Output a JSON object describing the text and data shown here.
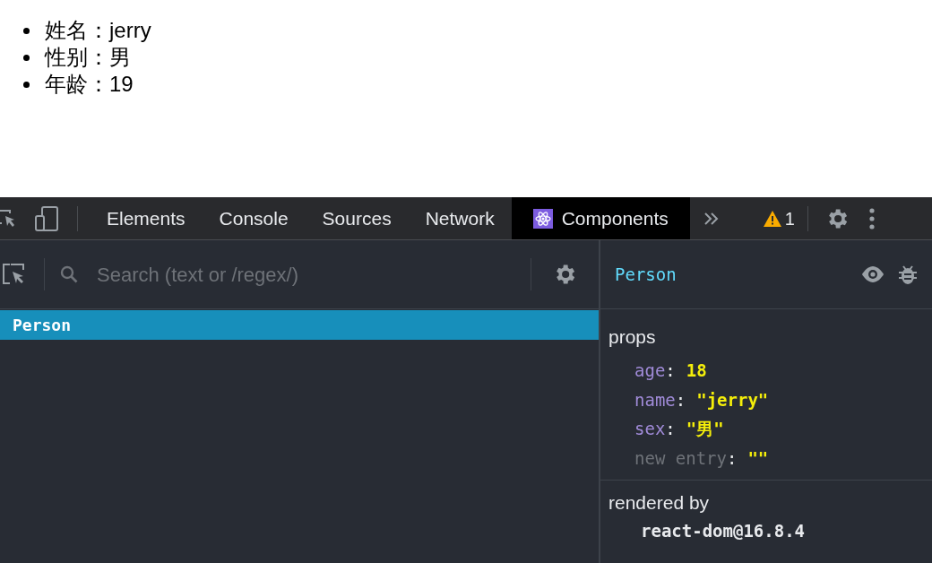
{
  "page_list": [
    "姓名：jerry",
    "性别：男",
    "年龄：19"
  ],
  "tabs": [
    {
      "label": "Elements",
      "selected": false
    },
    {
      "label": "Console",
      "selected": false
    },
    {
      "label": "Sources",
      "selected": false
    },
    {
      "label": "Network",
      "selected": false
    },
    {
      "label": "Components",
      "selected": true,
      "kind": "react"
    }
  ],
  "warning_count": "1",
  "search": {
    "placeholder": "Search (text or /regex/)"
  },
  "tree": [
    {
      "label": "Person",
      "selected": true
    }
  ],
  "inspector": {
    "component": "Person",
    "props_title": "props",
    "separator": ":",
    "props": [
      {
        "kind": "prop",
        "key": "age",
        "value": "18"
      },
      {
        "kind": "prop",
        "key": "name",
        "value": "\"jerry\""
      },
      {
        "kind": "prop",
        "key": "sex",
        "value": "\"男\""
      },
      {
        "kind": "new-entry",
        "key": "new entry",
        "value": "\"\""
      }
    ],
    "rendered_by_title": "rendered by",
    "rendered_by": "react-dom@16.8.4"
  }
}
